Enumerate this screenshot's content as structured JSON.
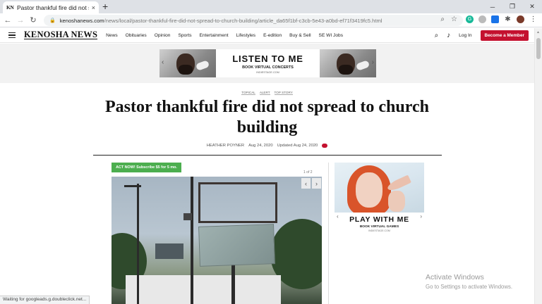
{
  "browser": {
    "tab_favicon": "KN",
    "tab_title": "Pastor thankful fire did not spread",
    "tab_close": "×",
    "new_tab": "+",
    "url_host": "kenoshanews.com",
    "url_path": "/news/local/pastor-thankful-fire-did-not-spread-to-church-building/article_da65f1bf-c3cb-5e43-a0bd-ef71f3419fc5.html",
    "status_text": "Waiting for googleads.g.doubleclick.net..."
  },
  "site": {
    "logo": "KENOSHA NEWS",
    "nav": [
      "News",
      "Obituaries",
      "Opinion",
      "Sports",
      "Entertainment",
      "Lifestyles",
      "E-edition",
      "Buy & Sell",
      "SE WI Jobs"
    ],
    "login": "Log In",
    "member_button": "Become a Member"
  },
  "ad_top": {
    "headline": "LISTEN TO ME",
    "subline": "BOOK VIRTUAL CONCERTS",
    "site": "INDIESTAGE.COM"
  },
  "article": {
    "tags": [
      "TOPICAL",
      "ALERT",
      "TOP STORY"
    ],
    "headline": "Pastor thankful fire did not spread to church building",
    "author": "HEATHER POYNER",
    "date": "Aug 24, 2020",
    "updated": "Updated Aug 24, 2020",
    "promo": "ACT NOW! Subscribe $5 for 5 mo.",
    "photo_counter": "1 of 2"
  },
  "ad_side": {
    "headline": "PLAY WITH ME",
    "subline": "BOOK VIRTUAL GAMES",
    "site": "INDIESTAGE.COM"
  },
  "windows_watermark": {
    "line1": "Activate Windows",
    "line2": "Go to Settings to activate Windows."
  },
  "colors": {
    "brand_red": "#c4112f",
    "promo_green": "#4cae4f"
  }
}
